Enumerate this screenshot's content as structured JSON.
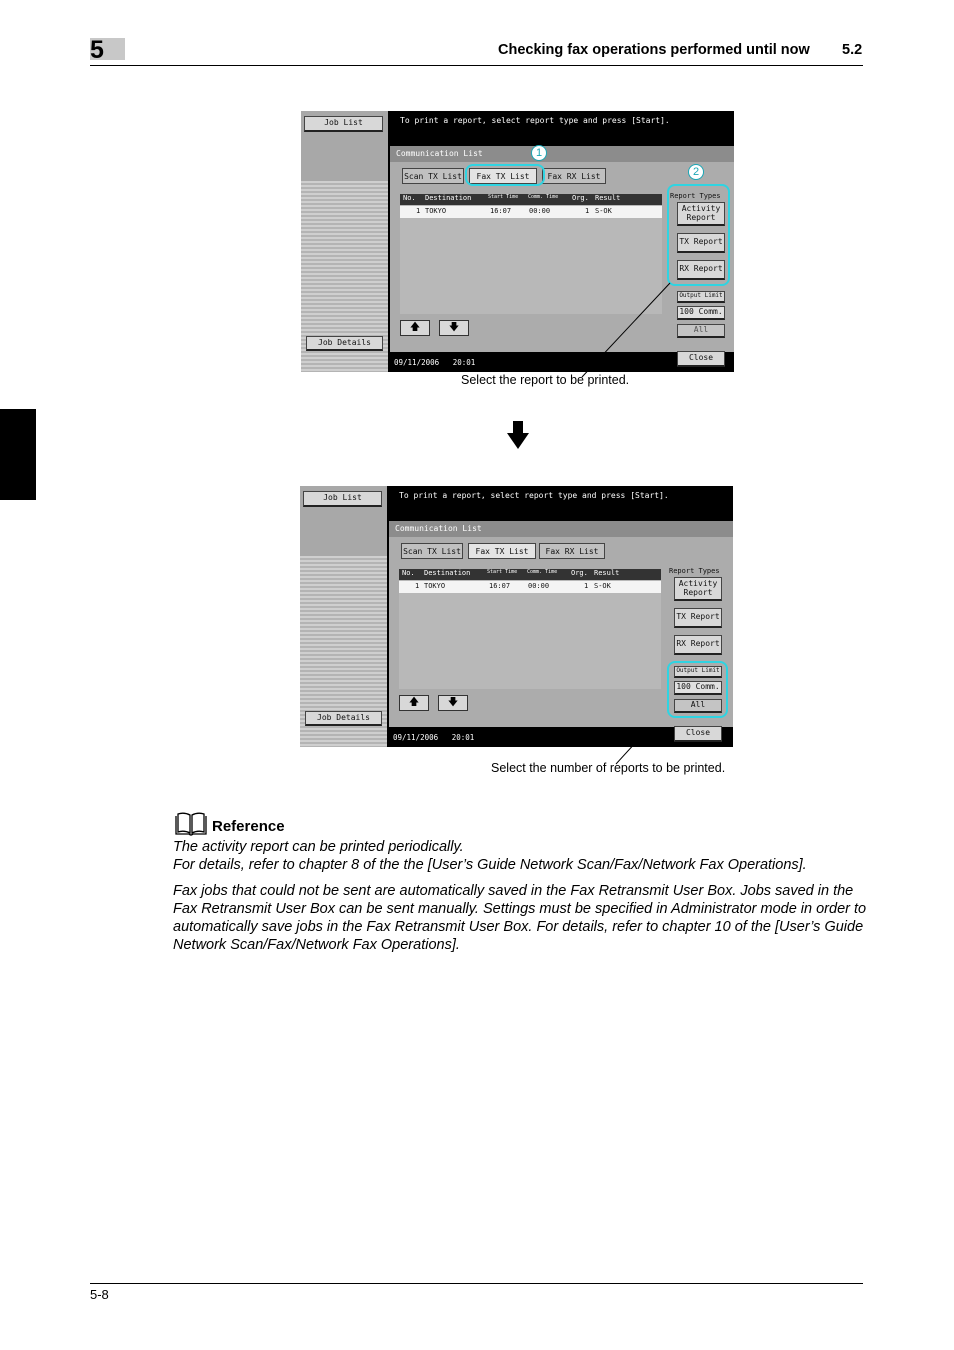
{
  "header": {
    "chapter": "5",
    "title": "Checking fax operations performed until now",
    "section": "5.2"
  },
  "footer": {
    "page": "5-8"
  },
  "screen1": {
    "job_list": "Job List",
    "job_details": "Job Details",
    "message": "To print a report, select report type and press [Start].",
    "panel_title": "Communication List",
    "tabs": [
      "Scan TX List",
      "Fax TX List",
      "Fax RX List"
    ],
    "columns": [
      "No.",
      "Destination",
      "Start Time",
      "Comm. Time",
      "Org.",
      "Result"
    ],
    "row": [
      "1",
      "TOKYO",
      "16:07",
      "00:00",
      "1",
      "S-OK"
    ],
    "report_types": "Report Types",
    "btn_activity": "Activity Report",
    "btn_tx": "TX Report",
    "btn_rx": "RX Report",
    "output_limit": "Output Limit",
    "btn_100": "100 Comm.",
    "btn_all": "All",
    "btn_close": "Close",
    "date": "09/11/2006",
    "time": "20:01",
    "marker1": "1",
    "marker2": "2"
  },
  "caption1": "Select the report to be printed.",
  "caption2": "Select the number of reports to be printed.",
  "reference": {
    "title": "Reference",
    "line1": "The activity report can be printed periodically.",
    "line2": "For details, refer to chapter 8 of the the [User’s Guide Network Scan/Fax/Network Fax Operations].",
    "paragraph": "Fax jobs that could not be sent are automatically saved in the Fax Retransmit User Box. Jobs saved in the Fax Retransmit User Box can be sent manually. Settings must be specified in Administrator mode in order to automatically save jobs in the Fax Retransmit User Box. For details, refer to chapter 10 of the [User’s Guide Network Scan/Fax/Network Fax Operations]."
  },
  "colors": {
    "highlight": "#2fd4e2",
    "tab_black": "#000000"
  }
}
